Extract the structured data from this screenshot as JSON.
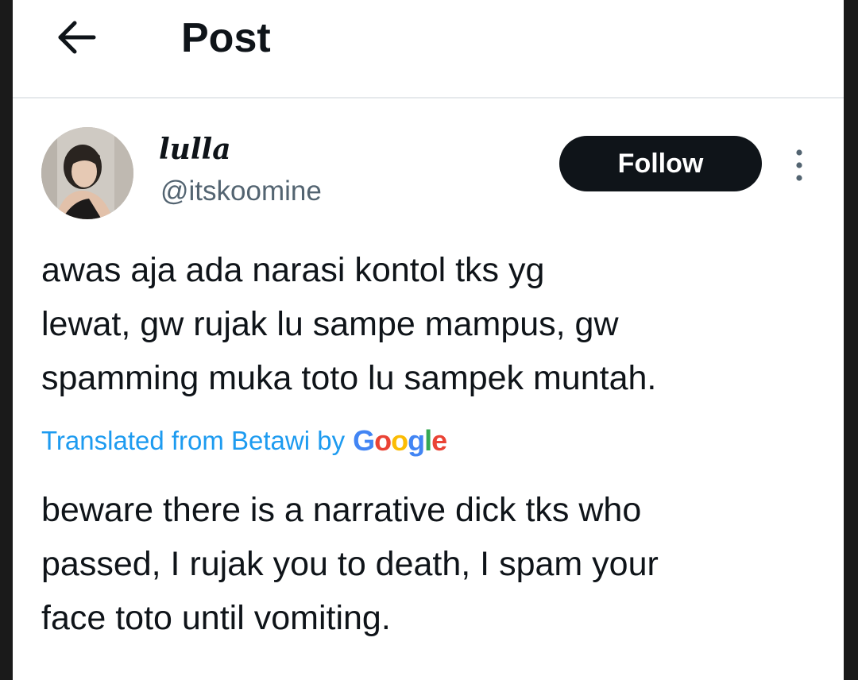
{
  "header": {
    "back_icon": "arrow-left-icon",
    "title": "Post"
  },
  "post": {
    "author": {
      "display_name": "lulla",
      "handle": "@itskoomine",
      "avatar": "profile-photo"
    },
    "follow_label": "Follow",
    "more_icon": "vertical-dots-icon",
    "text_lines": [
      "awas aja ada narasi kontol tks yg",
      "lewat, gw rujak lu sampe mampus, gw",
      "spamming muka toto lu sampek muntah."
    ],
    "translated_label": "Translated from Betawi by",
    "translation_provider": [
      "G",
      "o",
      "o",
      "g",
      "l",
      "e"
    ],
    "translation_lines": [
      "beware there is a narrative dick tks who",
      "passed, I rujak you to death, I spam your",
      "face toto until vomiting."
    ]
  },
  "colors": {
    "link_blue": "#1d9bf0",
    "text_primary": "#0f1419",
    "text_secondary": "#536471",
    "button_dark": "#0f1419"
  }
}
